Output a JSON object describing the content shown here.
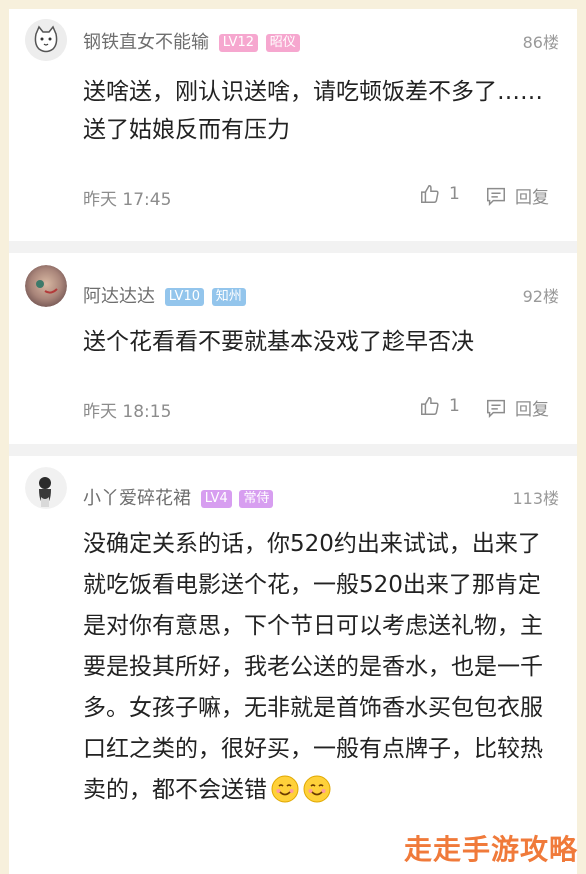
{
  "comments": [
    {
      "username": "钢铁直女不能输",
      "level": "LV12",
      "tag": "昭仪",
      "floor": "86楼",
      "text": "送啥送，刚认识送啥，请吃顿饭差不多了……送了姑娘反而有压力",
      "time": "昨天 17:45",
      "likes": "1",
      "reply_label": "回复",
      "colors": {
        "level": "#f6a7cf",
        "tag": "#f6a7cf"
      }
    },
    {
      "username": "阿达达达",
      "level": "LV10",
      "tag": "知州",
      "floor": "92楼",
      "text": "送个花看看不要就基本没戏了趁早否决",
      "time": "昨天 18:15",
      "likes": "1",
      "reply_label": "回复",
      "colors": {
        "level": "#93c5ec",
        "tag": "#93c5ec"
      }
    },
    {
      "username": "小丫爱碎花裙",
      "level": "LV4",
      "tag": "常侍",
      "floor": "113楼",
      "text": "没确定关系的话，你520约出来试试，出来了就吃饭看电影送个花，一般520出来了那肯定是对你有意思，下个节日可以考虑送礼物，主要是投其所好，我老公送的是香水，也是一千多。女孩子嘛，无非就是首饰香水买包包衣服口红之类的，很好买，一般有点牌子，比较热卖的，都不会送错",
      "colors": {
        "level": "#d79ef0",
        "tag": "#d79ef0"
      }
    }
  ],
  "watermark": "走走手游攻略"
}
